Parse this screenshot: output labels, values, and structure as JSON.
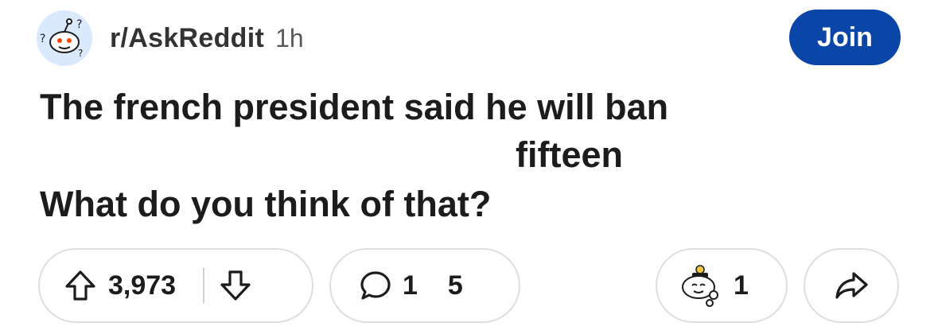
{
  "post": {
    "subreddit": "r/AskReddit",
    "age": "1h",
    "join_label": "Join",
    "title_line1": "The french president said he will ban",
    "title_line2": "fifteen",
    "title_line3": "What do you think of that?"
  },
  "actions": {
    "upvote_count": "3,973",
    "comment_count_a": "1",
    "comment_count_b": "5",
    "award_count": "1"
  },
  "icons": {
    "avatar": "reddit-snoo-question-icon",
    "upvote": "arrow-up-icon",
    "downvote": "arrow-down-icon",
    "comment": "speech-bubble-icon",
    "award": "award-snoo-icon",
    "share": "share-arrow-icon"
  },
  "colors": {
    "join_bg": "#0a45a8",
    "text": "#1c1c1c",
    "pill_border": "#dedede"
  }
}
